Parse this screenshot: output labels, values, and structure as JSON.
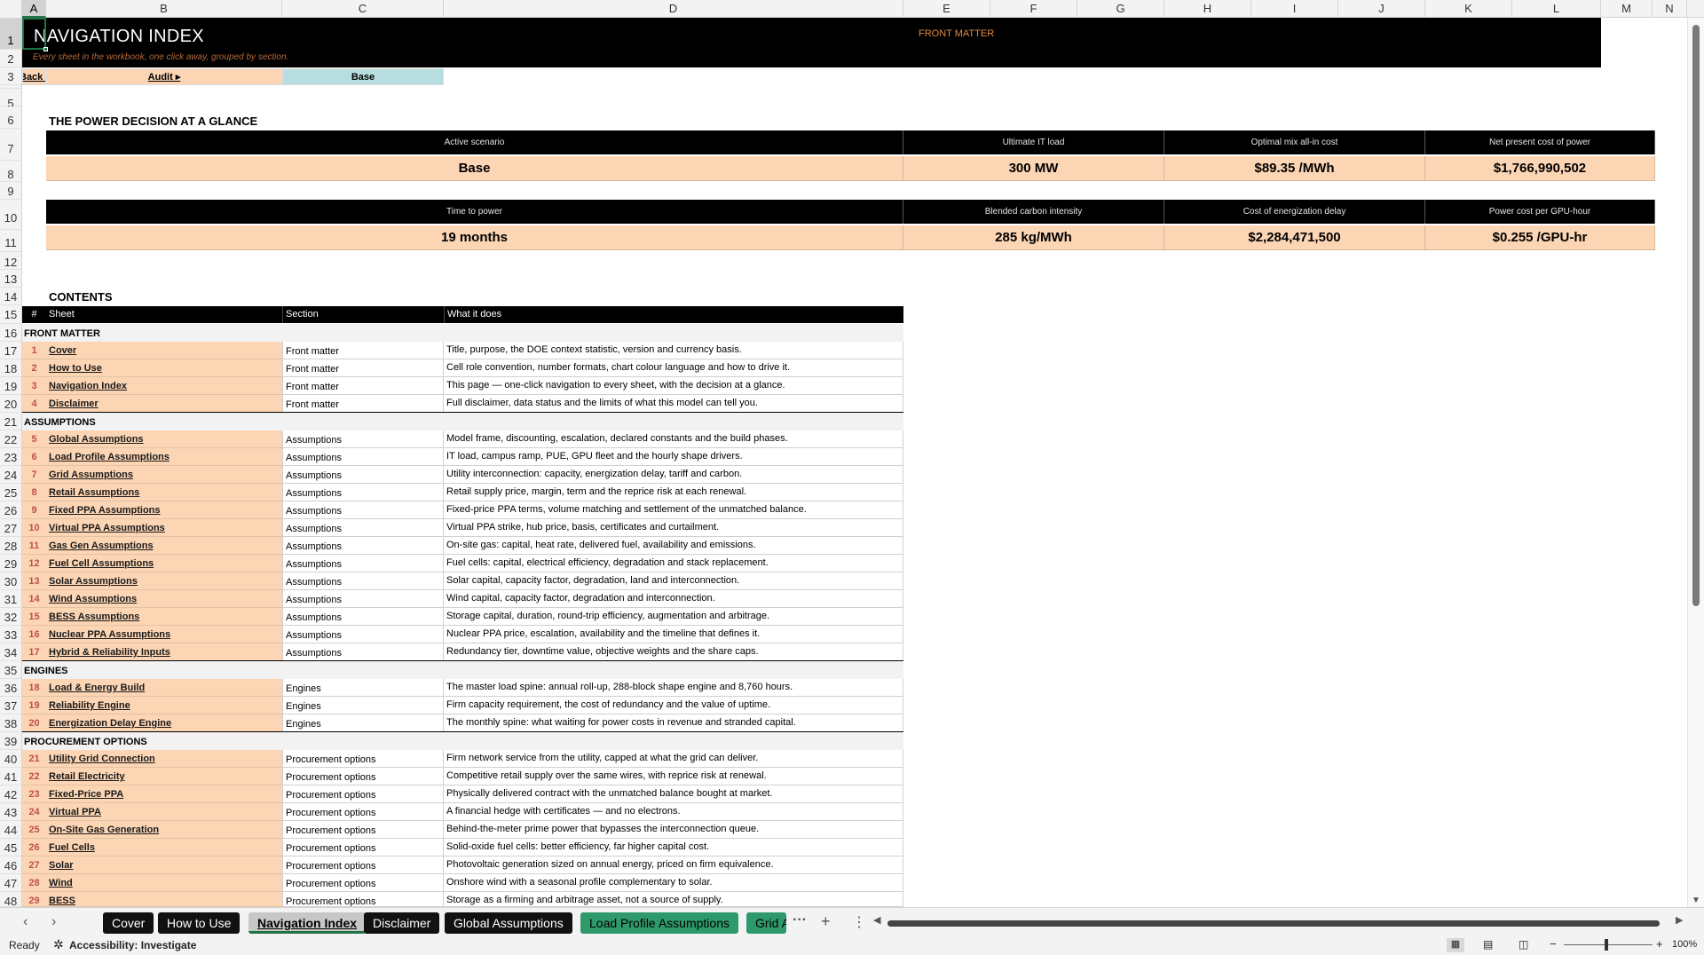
{
  "columns": [
    "A",
    "B",
    "C",
    "D",
    "E",
    "F",
    "G",
    "H",
    "I",
    "J",
    "K",
    "L",
    "M",
    "N"
  ],
  "rows": [
    "1",
    "2",
    "3",
    "4",
    "5",
    "6",
    "7",
    "8",
    "9",
    "10",
    "11",
    "12",
    "13",
    "14",
    "15",
    "16",
    "17",
    "18",
    "19",
    "20",
    "21",
    "22",
    "23",
    "24",
    "25",
    "26",
    "27",
    "28",
    "29",
    "30",
    "31",
    "32",
    "33",
    "34",
    "35",
    "36",
    "37",
    "38",
    "39",
    "40",
    "41",
    "42",
    "43",
    "44",
    "45",
    "46",
    "47",
    "48"
  ],
  "header": {
    "title": "NAVIGATION INDEX",
    "subtitle": "Every sheet in the workbook, one click away, grouped by section.",
    "tag": "FRONT MATTER"
  },
  "nav": {
    "back": "Back to",
    "audit": "Audit ▸",
    "scenario": "Base"
  },
  "glance": {
    "heading": "THE POWER DECISION AT A GLANCE",
    "row1": [
      {
        "label": "Active scenario",
        "value": "Base"
      },
      {
        "label": "Ultimate IT load",
        "value": "300 MW"
      },
      {
        "label": "Optimal mix all-in cost",
        "value": "$89.35 /MWh"
      },
      {
        "label": "Net present cost of power",
        "value": "$1,766,990,502"
      }
    ],
    "row2": [
      {
        "label": "Time to power",
        "value": "19 months"
      },
      {
        "label": "Blended carbon intensity",
        "value": "285 kg/MWh"
      },
      {
        "label": "Cost of energization delay",
        "value": "$2,284,471,500"
      },
      {
        "label": "Power cost per GPU-hour",
        "value": "$0.255 /GPU-hr"
      }
    ]
  },
  "contents": {
    "heading": "CONTENTS",
    "columns": [
      "#",
      "Sheet",
      "Section",
      "What it does"
    ],
    "groups": [
      {
        "name": "FRONT MATTER",
        "rows": [
          {
            "num": "1",
            "sheet": "Cover",
            "section": "Front matter",
            "what": "Title, purpose, the DOE context statistic, version and currency basis."
          },
          {
            "num": "2",
            "sheet": "How to Use",
            "section": "Front matter",
            "what": "Cell role convention, number formats, chart colour language and how to drive it."
          },
          {
            "num": "3",
            "sheet": "Navigation Index",
            "section": "Front matter",
            "what": "This page — one-click navigation to every sheet, with the decision at a glance."
          },
          {
            "num": "4",
            "sheet": "Disclaimer",
            "section": "Front matter",
            "what": "Full disclaimer, data status and the limits of what this model can tell you."
          }
        ]
      },
      {
        "name": "ASSUMPTIONS",
        "rows": [
          {
            "num": "5",
            "sheet": "Global Assumptions",
            "section": "Assumptions",
            "what": "Model frame, discounting, escalation, declared constants and the build phases."
          },
          {
            "num": "6",
            "sheet": "Load Profile Assumptions",
            "section": "Assumptions",
            "what": "IT load, campus ramp, PUE, GPU fleet and the hourly shape drivers."
          },
          {
            "num": "7",
            "sheet": "Grid Assumptions",
            "section": "Assumptions",
            "what": "Utility interconnection: capacity, energization delay, tariff and carbon."
          },
          {
            "num": "8",
            "sheet": "Retail Assumptions",
            "section": "Assumptions",
            "what": "Retail supply price, margin, term and the reprice risk at each renewal."
          },
          {
            "num": "9",
            "sheet": "Fixed PPA Assumptions",
            "section": "Assumptions",
            "what": "Fixed-price PPA terms, volume matching and settlement of the unmatched balance."
          },
          {
            "num": "10",
            "sheet": "Virtual PPA Assumptions",
            "section": "Assumptions",
            "what": "Virtual PPA strike, hub price, basis, certificates and curtailment."
          },
          {
            "num": "11",
            "sheet": "Gas Gen Assumptions",
            "section": "Assumptions",
            "what": "On-site gas: capital, heat rate, delivered fuel, availability and emissions."
          },
          {
            "num": "12",
            "sheet": "Fuel Cell Assumptions",
            "section": "Assumptions",
            "what": "Fuel cells: capital, electrical efficiency, degradation and stack replacement."
          },
          {
            "num": "13",
            "sheet": "Solar Assumptions",
            "section": "Assumptions",
            "what": "Solar capital, capacity factor, degradation, land and interconnection."
          },
          {
            "num": "14",
            "sheet": "Wind Assumptions",
            "section": "Assumptions",
            "what": "Wind capital, capacity factor, degradation and interconnection."
          },
          {
            "num": "15",
            "sheet": "BESS Assumptions",
            "section": "Assumptions",
            "what": "Storage capital, duration, round-trip efficiency, augmentation and arbitrage."
          },
          {
            "num": "16",
            "sheet": "Nuclear PPA Assumptions",
            "section": "Assumptions",
            "what": "Nuclear PPA price, escalation, availability and the timeline that defines it."
          },
          {
            "num": "17",
            "sheet": "Hybrid & Reliability Inputs",
            "section": "Assumptions",
            "what": "Redundancy tier, downtime value, objective weights and the share caps."
          }
        ]
      },
      {
        "name": "ENGINES",
        "rows": [
          {
            "num": "18",
            "sheet": "Load & Energy Build",
            "section": "Engines",
            "what": "The master load spine: annual roll-up, 288-block shape engine and 8,760 hours."
          },
          {
            "num": "19",
            "sheet": "Reliability Engine",
            "section": "Engines",
            "what": "Firm capacity requirement, the cost of redundancy and the value of uptime."
          },
          {
            "num": "20",
            "sheet": "Energization Delay Engine",
            "section": "Engines",
            "what": "The monthly spine: what waiting for power costs in revenue and stranded capital."
          }
        ]
      },
      {
        "name": "PROCUREMENT OPTIONS",
        "rows": [
          {
            "num": "21",
            "sheet": "Utility Grid Connection",
            "section": "Procurement options",
            "what": "Firm network service from the utility, capped at what the grid can deliver."
          },
          {
            "num": "22",
            "sheet": "Retail Electricity",
            "section": "Procurement options",
            "what": "Competitive retail supply over the same wires, with reprice risk at renewal."
          },
          {
            "num": "23",
            "sheet": "Fixed-Price PPA",
            "section": "Procurement options",
            "what": "Physically delivered contract with the unmatched balance bought at market."
          },
          {
            "num": "24",
            "sheet": "Virtual PPA",
            "section": "Procurement options",
            "what": "A financial hedge with certificates — and no electrons."
          },
          {
            "num": "25",
            "sheet": "On-Site Gas Generation",
            "section": "Procurement options",
            "what": "Behind-the-meter prime power that bypasses the interconnection queue."
          },
          {
            "num": "26",
            "sheet": "Fuel Cells",
            "section": "Procurement options",
            "what": "Solid-oxide fuel cells: better efficiency, far higher capital cost."
          },
          {
            "num": "27",
            "sheet": "Solar",
            "section": "Procurement options",
            "what": "Photovoltaic generation sized on annual energy, priced on firm equivalence."
          },
          {
            "num": "28",
            "sheet": "Wind",
            "section": "Procurement options",
            "what": "Onshore wind with a seasonal profile complementary to solar."
          },
          {
            "num": "29",
            "sheet": "BESS",
            "section": "Procurement options",
            "what": "Storage as a firming and arbitrage asset, not a source of supply."
          }
        ]
      }
    ]
  },
  "tabs": {
    "items": [
      "Cover",
      "How to Use",
      "Navigation Index",
      "Disclaimer",
      "Global Assumptions",
      "Load Profile Assumptions",
      "Grid Assumptions"
    ],
    "active": "Navigation Index",
    "more": "···",
    "add": "+",
    "menu": "⋮"
  },
  "status": {
    "ready": "Ready",
    "accessibility": "Accessibility: Investigate",
    "zoom": "100%"
  },
  "colors": {
    "accent": "#217346",
    "peach": "#fcd5b4",
    "teal": "#b7dde0",
    "black_band": "#000000",
    "tab_green": "#2e9a6b"
  },
  "icons": [
    "tab-prev-icon",
    "tab-next-icon",
    "accessibility-icon",
    "normal-view-icon",
    "page-layout-icon",
    "page-break-icon",
    "zoom-minus-icon",
    "zoom-plus-icon"
  ]
}
